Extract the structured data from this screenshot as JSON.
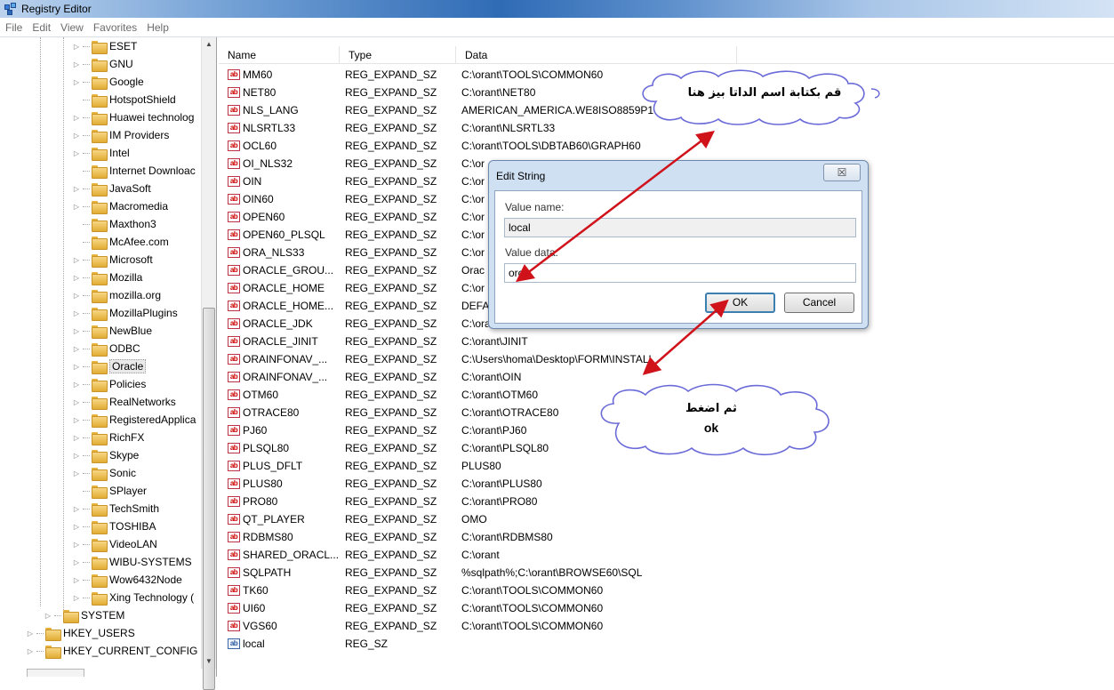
{
  "window": {
    "title": "Registry Editor"
  },
  "menu": [
    "File",
    "Edit",
    "View",
    "Favorites",
    "Help"
  ],
  "tree": {
    "children": [
      {
        "label": "ESET",
        "expandable": true
      },
      {
        "label": "GNU",
        "expandable": true
      },
      {
        "label": "Google",
        "expandable": true
      },
      {
        "label": "HotspotShield",
        "expandable": false
      },
      {
        "label": "Huawei technolog",
        "expandable": true
      },
      {
        "label": "IM Providers",
        "expandable": true
      },
      {
        "label": "Intel",
        "expandable": true
      },
      {
        "label": "Internet Downloac",
        "expandable": false
      },
      {
        "label": "JavaSoft",
        "expandable": true
      },
      {
        "label": "Macromedia",
        "expandable": true
      },
      {
        "label": "Maxthon3",
        "expandable": false
      },
      {
        "label": "McAfee.com",
        "expandable": false
      },
      {
        "label": "Microsoft",
        "expandable": true
      },
      {
        "label": "Mozilla",
        "expandable": true
      },
      {
        "label": "mozilla.org",
        "expandable": true
      },
      {
        "label": "MozillaPlugins",
        "expandable": true
      },
      {
        "label": "NewBlue",
        "expandable": true
      },
      {
        "label": "ODBC",
        "expandable": true
      },
      {
        "label": "Oracle",
        "expandable": true,
        "selected": true
      },
      {
        "label": "Policies",
        "expandable": true
      },
      {
        "label": "RealNetworks",
        "expandable": true
      },
      {
        "label": "RegisteredApplica",
        "expandable": true
      },
      {
        "label": "RichFX",
        "expandable": true
      },
      {
        "label": "Skype",
        "expandable": true
      },
      {
        "label": "Sonic",
        "expandable": true
      },
      {
        "label": "SPlayer",
        "expandable": false
      },
      {
        "label": "TechSmith",
        "expandable": true
      },
      {
        "label": "TOSHIBA",
        "expandable": true
      },
      {
        "label": "VideoLAN",
        "expandable": true
      },
      {
        "label": "WIBU-SYSTEMS",
        "expandable": true
      },
      {
        "label": "Wow6432Node",
        "expandable": true
      },
      {
        "label": "Xing Technology (",
        "expandable": true
      }
    ],
    "level2": [
      {
        "label": "SYSTEM"
      }
    ],
    "roots": [
      {
        "label": "HKEY_USERS"
      },
      {
        "label": "HKEY_CURRENT_CONFIG"
      }
    ]
  },
  "columns": {
    "name": "Name",
    "type": "Type",
    "data": "Data"
  },
  "values": [
    {
      "name": "MM60",
      "type": "REG_EXPAND_SZ",
      "data": "C:\\orant\\TOOLS\\COMMON60"
    },
    {
      "name": "NET80",
      "type": "REG_EXPAND_SZ",
      "data": "C:\\orant\\NET80"
    },
    {
      "name": "NLS_LANG",
      "type": "REG_EXPAND_SZ",
      "data": "AMERICAN_AMERICA.WE8ISO8859P1"
    },
    {
      "name": "NLSRTL33",
      "type": "REG_EXPAND_SZ",
      "data": "C:\\orant\\NLSRTL33"
    },
    {
      "name": "OCL60",
      "type": "REG_EXPAND_SZ",
      "data": "C:\\orant\\TOOLS\\DBTAB60\\GRAPH60"
    },
    {
      "name": "OI_NLS32",
      "type": "REG_EXPAND_SZ",
      "data": "C:\\or"
    },
    {
      "name": "OIN",
      "type": "REG_EXPAND_SZ",
      "data": "C:\\or"
    },
    {
      "name": "OIN60",
      "type": "REG_EXPAND_SZ",
      "data": "C:\\or"
    },
    {
      "name": "OPEN60",
      "type": "REG_EXPAND_SZ",
      "data": "C:\\or"
    },
    {
      "name": "OPEN60_PLSQL",
      "type": "REG_EXPAND_SZ",
      "data": "C:\\or"
    },
    {
      "name": "ORA_NLS33",
      "type": "REG_EXPAND_SZ",
      "data": "C:\\or"
    },
    {
      "name": "ORACLE_GROU...",
      "type": "REG_EXPAND_SZ",
      "data": "Orac"
    },
    {
      "name": "ORACLE_HOME",
      "type": "REG_EXPAND_SZ",
      "data": "C:\\or"
    },
    {
      "name": "ORACLE_HOME...",
      "type": "REG_EXPAND_SZ",
      "data": "DEFA"
    },
    {
      "name": "ORACLE_JDK",
      "type": "REG_EXPAND_SZ",
      "data": "C:\\orant\\JDK\\"
    },
    {
      "name": "ORACLE_JINIT",
      "type": "REG_EXPAND_SZ",
      "data": "C:\\orant\\JINIT"
    },
    {
      "name": "ORAINFONAV_...",
      "type": "REG_EXPAND_SZ",
      "data": "C:\\Users\\homa\\Desktop\\FORM\\INSTALL"
    },
    {
      "name": "ORAINFONAV_...",
      "type": "REG_EXPAND_SZ",
      "data": "C:\\orant\\OIN"
    },
    {
      "name": "OTM60",
      "type": "REG_EXPAND_SZ",
      "data": "C:\\orant\\OTM60"
    },
    {
      "name": "OTRACE80",
      "type": "REG_EXPAND_SZ",
      "data": "C:\\orant\\OTRACE80"
    },
    {
      "name": "PJ60",
      "type": "REG_EXPAND_SZ",
      "data": "C:\\orant\\PJ60"
    },
    {
      "name": "PLSQL80",
      "type": "REG_EXPAND_SZ",
      "data": "C:\\orant\\PLSQL80"
    },
    {
      "name": "PLUS_DFLT",
      "type": "REG_EXPAND_SZ",
      "data": "PLUS80"
    },
    {
      "name": "PLUS80",
      "type": "REG_EXPAND_SZ",
      "data": "C:\\orant\\PLUS80"
    },
    {
      "name": "PRO80",
      "type": "REG_EXPAND_SZ",
      "data": "C:\\orant\\PRO80"
    },
    {
      "name": "QT_PLAYER",
      "type": "REG_EXPAND_SZ",
      "data": "OMO"
    },
    {
      "name": "RDBMS80",
      "type": "REG_EXPAND_SZ",
      "data": "C:\\orant\\RDBMS80"
    },
    {
      "name": "SHARED_ORACL...",
      "type": "REG_EXPAND_SZ",
      "data": "C:\\orant"
    },
    {
      "name": "SQLPATH",
      "type": "REG_EXPAND_SZ",
      "data": "%sqlpath%;C:\\orant\\BROWSE60\\SQL"
    },
    {
      "name": "TK60",
      "type": "REG_EXPAND_SZ",
      "data": "C:\\orant\\TOOLS\\COMMON60"
    },
    {
      "name": "UI60",
      "type": "REG_EXPAND_SZ",
      "data": "C:\\orant\\TOOLS\\COMMON60"
    },
    {
      "name": "VGS60",
      "type": "REG_EXPAND_SZ",
      "data": "C:\\orant\\TOOLS\\COMMON60"
    },
    {
      "name": "local",
      "type": "REG_SZ",
      "data": ""
    }
  ],
  "dialog": {
    "title": "Edit String",
    "close_label": "☒",
    "value_name_label": "Value name:",
    "value_name": "local",
    "value_data_label": "Value data:",
    "value_data": "orcl",
    "ok_label": "OK",
    "cancel_label": "Cancel"
  },
  "annotations": {
    "cloud1_text": "قم بكتابة اسم الداتا بيز هنا",
    "cloud2_line1": "ثم اضغط",
    "cloud2_line2": "ok",
    "arrow_color": "#d0121b"
  }
}
